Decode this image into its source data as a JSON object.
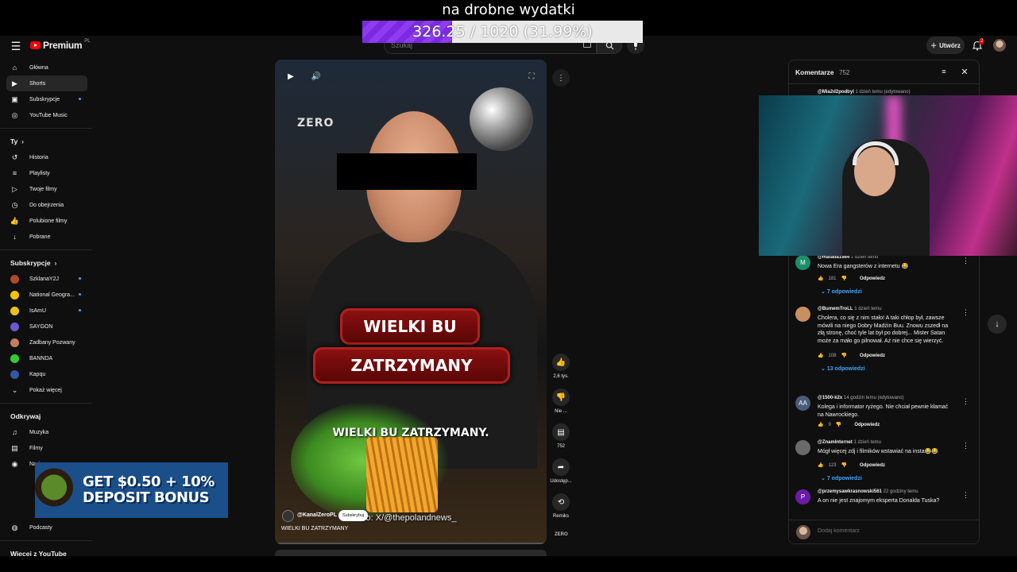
{
  "donation": {
    "title": "na drobne wydatki",
    "progress_text": "326.25 / 1020 (31.99%)",
    "progress_fraction": 0.3199
  },
  "topbar": {
    "logo": "Premium",
    "logo_region": "PL",
    "search_placeholder": "Szukaj",
    "create_label": "Utwórz",
    "notifications_count": "2"
  },
  "sidebar": {
    "main": [
      {
        "label": "Główna",
        "icon": "home-icon"
      },
      {
        "label": "Shorts",
        "icon": "shorts-icon"
      },
      {
        "label": "Subskrypcje",
        "icon": "subscriptions-icon"
      },
      {
        "label": "YouTube Music",
        "icon": "music-icon"
      }
    ],
    "you_heading": "Ty",
    "you": [
      {
        "label": "Historia",
        "icon": "history-icon"
      },
      {
        "label": "Playlisty",
        "icon": "playlists-icon"
      },
      {
        "label": "Twoje filmy",
        "icon": "your-videos-icon"
      },
      {
        "label": "Do obejrzenia",
        "icon": "watch-later-icon"
      },
      {
        "label": "Polubione filmy",
        "icon": "liked-icon"
      },
      {
        "label": "Pobrane",
        "icon": "download-icon"
      }
    ],
    "subs_heading": "Subskrypcje",
    "subs": [
      {
        "label": "SzklanaY2J",
        "color": "#b04a2a"
      },
      {
        "label": "National Geogra...",
        "color": "#f5c400"
      },
      {
        "label": "IsAmU",
        "color": "#e8c21a"
      },
      {
        "label": "SAYGON",
        "color": "#6a5acd"
      },
      {
        "label": "Zadbany Pozwany",
        "color": "#c08060"
      },
      {
        "label": "BANNDA",
        "color": "#33cc33"
      },
      {
        "label": "Kapqu",
        "color": "#3355aa"
      },
      {
        "label": "Pokaż więcej",
        "color": ""
      }
    ],
    "explore_heading": "Odkrywaj",
    "explore": [
      {
        "label": "Muzyka",
        "icon": "music-note-icon"
      },
      {
        "label": "Filmy",
        "icon": "film-icon"
      },
      {
        "label": "Na żywo",
        "icon": "live-icon"
      }
    ],
    "podcasts": "Podcasty",
    "more_heading": "Więcej z YouTube"
  },
  "ad": {
    "text": "GET $0.50 + 10% DEPOSIT BONUS"
  },
  "video": {
    "watermark": "ZERO",
    "banner_line1": "WIELKI BU",
    "banner_line2": "ZATRZYMANY",
    "caption": "WIELKI BU ZATRZYMANY.",
    "source_text": "dło: X/@thepolandnews_",
    "channel": "@KanalZeroPL",
    "subscribe_label": "Subskrybuj",
    "title": "WIELKI BU ZATRZYMANY"
  },
  "actions": {
    "likes": "2,6 tys.",
    "dislike": "Nie ...",
    "comments": "752",
    "share": "Udostęp...",
    "remix": "Remiks",
    "brand": "ZERO"
  },
  "comments_panel": {
    "title": "Komentarze",
    "count": "752",
    "partial_top": {
      "author": "@Mia2d2podbyl",
      "time": "1 dzień temu (edytowano)"
    },
    "items": [
      {
        "author": "@matada1984",
        "time": "1 dzień temu",
        "text": "Nowa Era gangsterów z internetu 😂",
        "likes": "181",
        "reply": "Odpowiedz",
        "replies": "7 odpowiedzi",
        "avatar": "M",
        "color": "#1b8f6a"
      },
      {
        "author": "@BumemTroLL",
        "time": "1 dzień temu",
        "text": "Cholera, co się z nim stało! A taki chłop był, zawsze mówili na niego Dobry Madżin Buu. Znowu zszedł na złą stronę, choć tyle lat był po dobrej... Mister Satan może za mało go pilnował. Aż nie chce się wierzyć.",
        "likes": "108",
        "reply": "Odpowiedz",
        "replies": "13 odpowiedzi",
        "avatar": "",
        "color": "#c89060"
      },
      {
        "author": "@1500-k2x",
        "time": "14 godzin temu (edytowano)",
        "text": "Kolega i informator ryżego. Nie chciał pewnie kłamać na Nawrockiego.",
        "likes": "9",
        "reply": "Odpowiedz",
        "replies": "",
        "avatar": "AA",
        "color": "#4a5a7a"
      },
      {
        "author": "@ZnamInternet",
        "time": "1 dzień temu",
        "text": "Mógł więcej zdj i filmików wstawiać na insta😂😂",
        "likes": "123",
        "reply": "Odpowiedz",
        "replies": "7 odpowiedzi",
        "avatar": "",
        "color": "#6a6a6a"
      },
      {
        "author": "@przemysawkrasnowski561",
        "time": "22 godziny temu",
        "text": "A on nie jest znajomym eksperta Donalda Tuska?",
        "likes": "",
        "reply": "",
        "replies": "",
        "avatar": "P",
        "color": "#6a1ba8"
      }
    ],
    "add_placeholder": "Dodaj komentarz"
  }
}
